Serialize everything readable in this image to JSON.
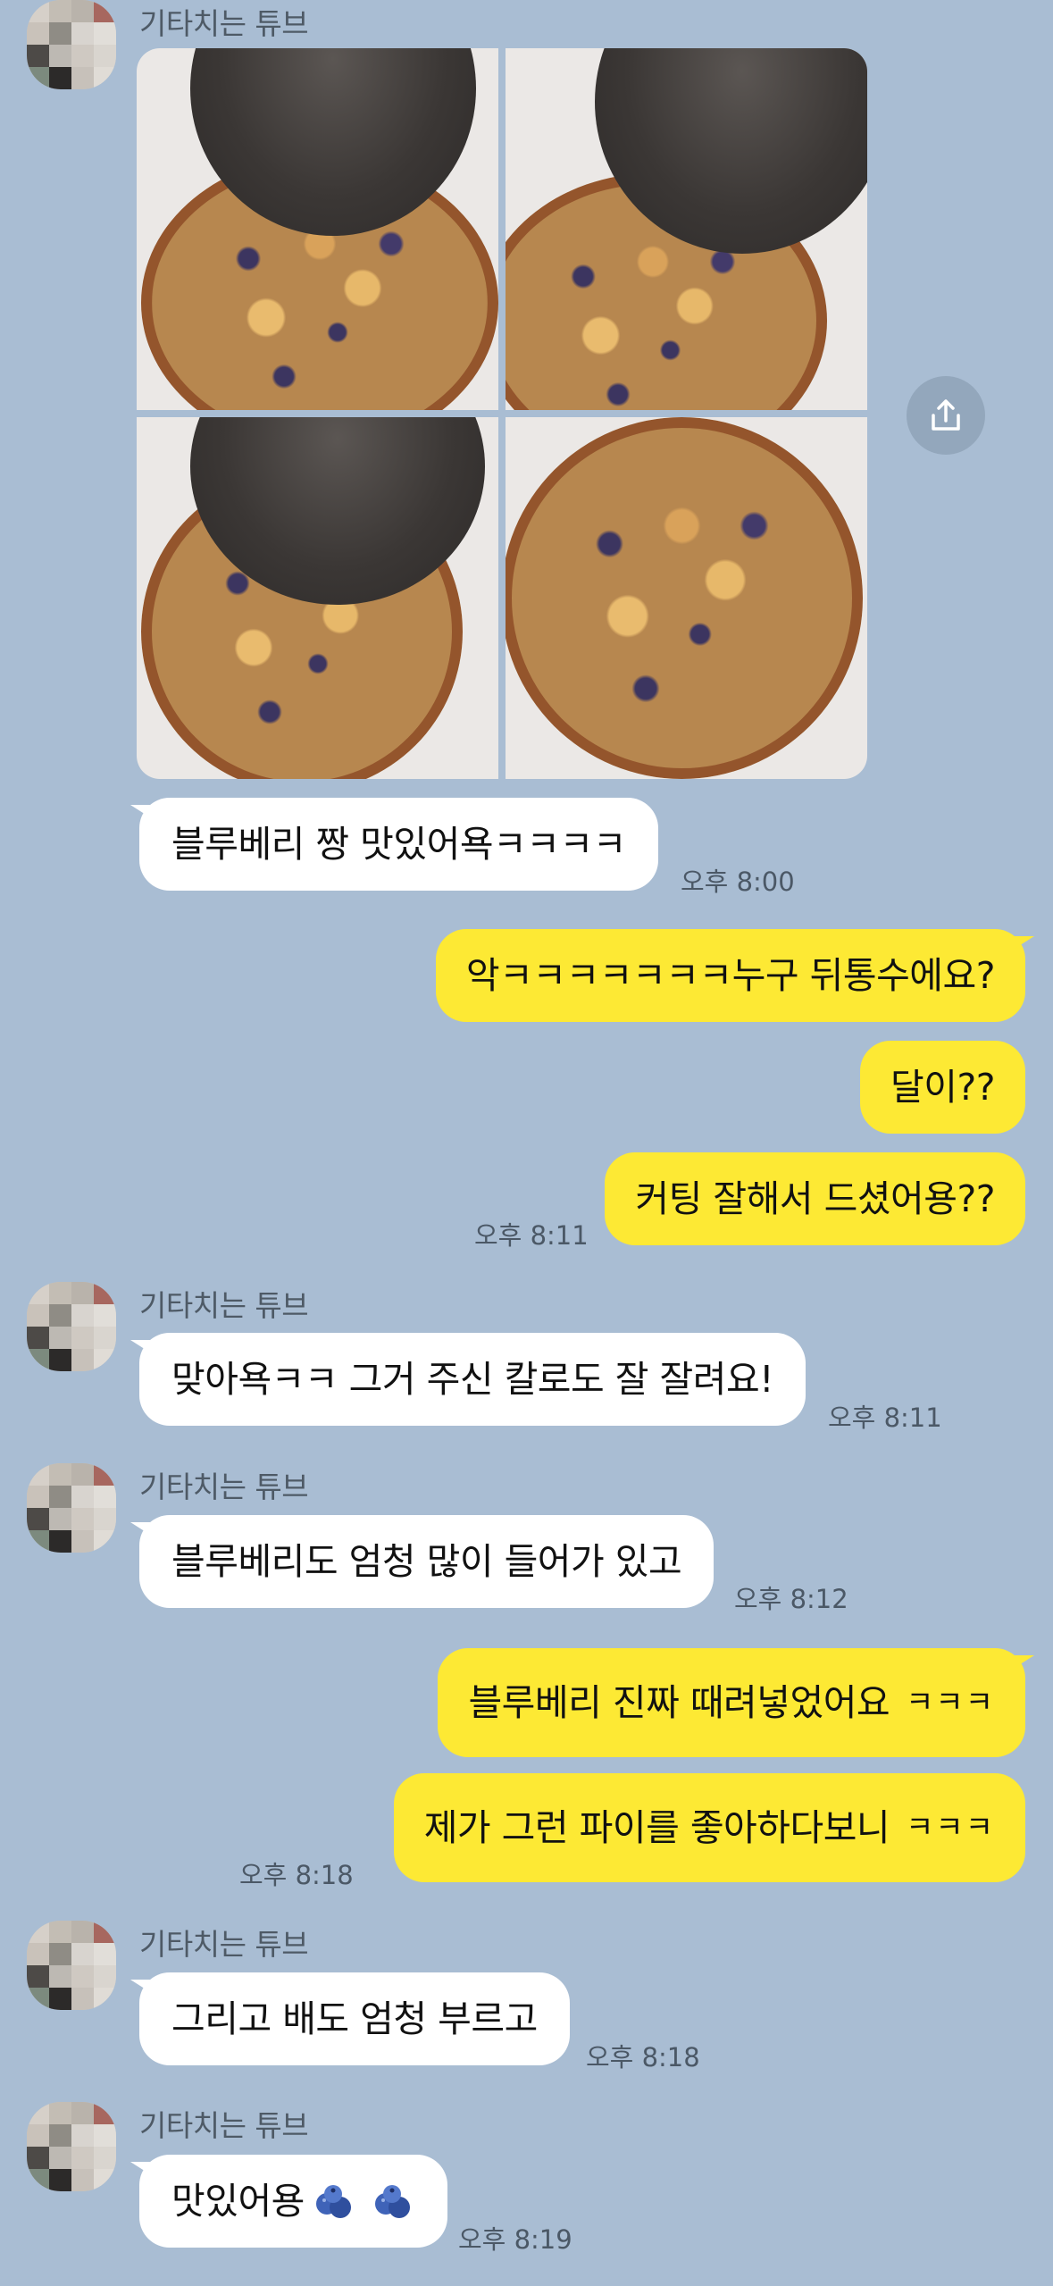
{
  "sender_name": "기타치는 튜브",
  "colors": {
    "background": "#a9bdd3",
    "incoming_bubble": "#ffffff",
    "outgoing_bubble": "#fde934"
  },
  "photo_grid": {
    "photos": [
      "cat-pie-1",
      "cat-pie-2",
      "cat-pie-3",
      "pie-4"
    ]
  },
  "messages": [
    {
      "id": "m1",
      "direction": "in",
      "text": "블루베리 짱 맛있어욕ㅋㅋㅋㅋ",
      "time": "오후 8:00"
    },
    {
      "id": "m2",
      "direction": "out",
      "text": "악ㅋㅋㅋㅋㅋㅋㅋ누구 뒤통수에요?"
    },
    {
      "id": "m3",
      "direction": "out",
      "text": "달이??"
    },
    {
      "id": "m4",
      "direction": "out",
      "text": "커팅 잘해서 드셨어용??",
      "time": "오후 8:11"
    },
    {
      "id": "m5",
      "direction": "in",
      "text": "맞아욕ㅋㅋ 그거 주신 칼로도 잘 잘려요!",
      "time": "오후 8:11"
    },
    {
      "id": "m6",
      "direction": "in",
      "text": "블루베리도 엄청 많이 들어가 있고",
      "time": "오후 8:12"
    },
    {
      "id": "m7",
      "direction": "out",
      "text": "블루베리 진짜 때려넣었어요",
      "emoji": "ㅋㅋㅋ"
    },
    {
      "id": "m8",
      "direction": "out",
      "text": "제가 그런 파이를 좋아하다보니",
      "emoji": "ㅋㅋㅋ",
      "time": "오후 8:18"
    },
    {
      "id": "m9",
      "direction": "in",
      "text": "그리고 배도 엄청 부르고",
      "time": "오후 8:18"
    },
    {
      "id": "m10",
      "direction": "in",
      "text": "맛있어용",
      "emoji_icon": "blueberry-icon",
      "time": "오후 8:19"
    }
  ]
}
